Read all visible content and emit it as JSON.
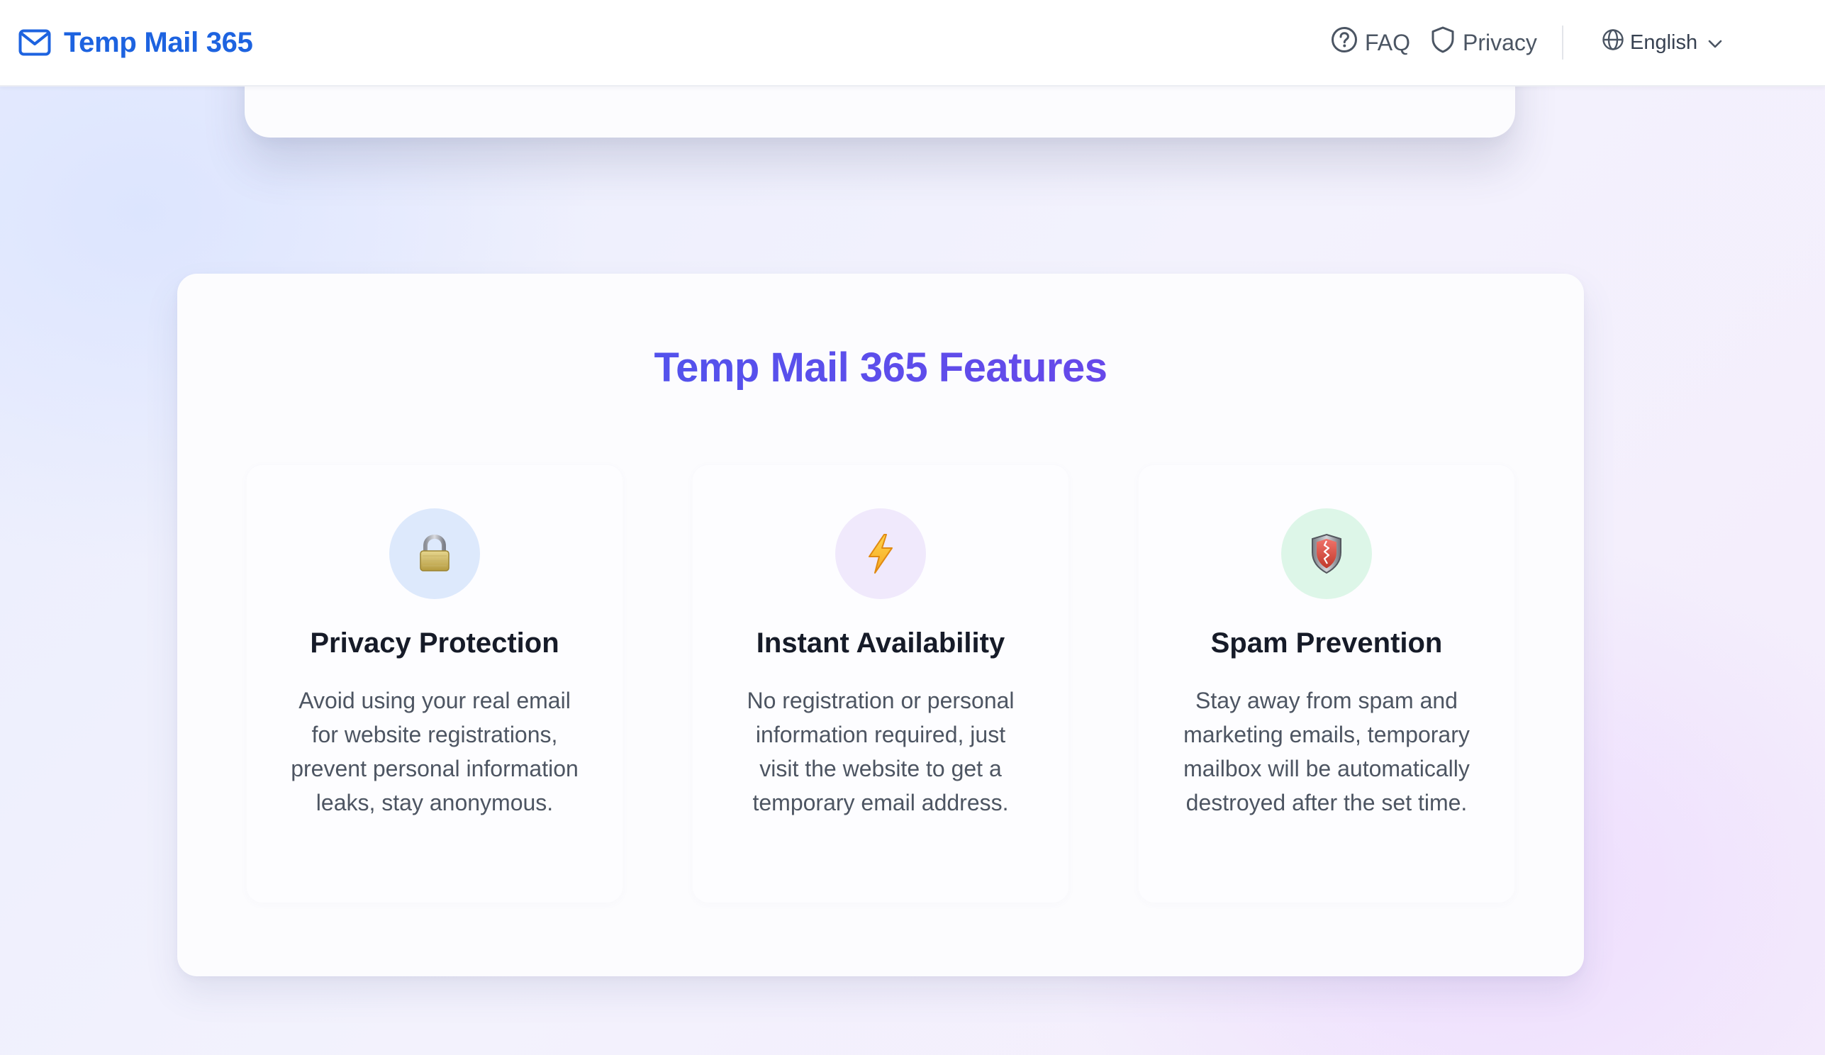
{
  "header": {
    "brand": "Temp Mail 365",
    "brand_icon": "mail-icon",
    "nav": {
      "faq_label": "FAQ",
      "faq_icon": "question-circle-icon",
      "privacy_label": "Privacy",
      "privacy_icon": "shield-icon"
    },
    "language": {
      "selected": "English",
      "icon": "globe-icon",
      "caret_icon": "chevron-down-icon"
    }
  },
  "features": {
    "title": "Temp Mail 365 Features",
    "items": [
      {
        "icon": "lock-icon",
        "icon_bg": "#dde9fc",
        "title": "Privacy Protection",
        "description": "Avoid using your real email for website registrations, prevent personal information leaks, stay anonymous."
      },
      {
        "icon": "lightning-icon",
        "icon_bg": "#f0e9fc",
        "title": "Instant Availability",
        "description": "No registration or personal information required, just visit the website to get a temporary email address."
      },
      {
        "icon": "shield-icon",
        "icon_bg": "#ddf6e8",
        "title": "Spam Prevention",
        "description": "Stay away from spam and marketing emails, temporary mailbox will be automatically destroyed after the set time."
      }
    ]
  },
  "colors": {
    "brand_blue": "#1d63e0",
    "title_gradient_start": "#3f5df0",
    "title_gradient_end": "#7a3ee6"
  }
}
